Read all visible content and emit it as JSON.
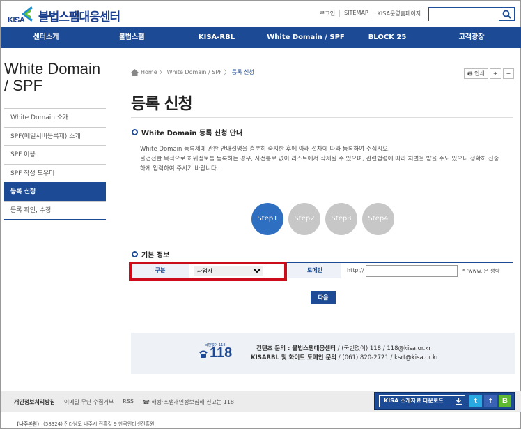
{
  "header": {
    "logo_text": "KISA",
    "site_title": "불법스팸대응센터",
    "top_links": [
      "로그인",
      "SITEMAP",
      "KISA운영홈페이지"
    ],
    "search_placeholder": ""
  },
  "gnb": [
    "센터소개",
    "불법스팸",
    "KISA-RBL",
    "White Domain / SPF",
    "BLOCK 25",
    "고객광장"
  ],
  "sidebar": {
    "title": "White Domain / SPF",
    "items": [
      {
        "label": "White Domain 소개",
        "active": false
      },
      {
        "label": "SPF(메일서버등록제) 소개",
        "active": false
      },
      {
        "label": "SPF 이용",
        "active": false
      },
      {
        "label": "SPF 작성 도우미",
        "active": false
      },
      {
        "label": "등록 신청",
        "active": true
      },
      {
        "label": "등록 확인, 수정",
        "active": false
      }
    ]
  },
  "breadcrumb": {
    "home": "Home",
    "parent": "White Domain / SPF",
    "current": "등록 신청"
  },
  "tools": {
    "print": "인쇄",
    "zoom_in": "+",
    "zoom_out": "−"
  },
  "page_title": "등록 신청",
  "section1": {
    "title": "White Domain 등록 신청 안내",
    "line1": "White Domain 등록제에 관한 안내설명을 충분히 숙지한 후에 아래 절차에 따라 등록하여 주십시오.",
    "line2": "불건전한 목적으로 허위정보를 등록하는 경우, 사전통보 없이 리스트에서 삭제될 수 있으며, 관련법령에 따라 처벌을 받을 수도 있으니 정확히 신중",
    "line3": "하게 입력하여 주시기 바랍니다."
  },
  "steps": [
    {
      "label": "Step1",
      "active": true
    },
    {
      "label": "Step2",
      "active": false
    },
    {
      "label": "Step3",
      "active": false
    },
    {
      "label": "Step4",
      "active": false
    }
  ],
  "section2": {
    "title": "기본 정보",
    "type_label": "구분",
    "type_value": "사업자",
    "domain_label": "도메인",
    "domain_prefix": "http://",
    "domain_value": "",
    "domain_hint": "* 'www.'은 생략"
  },
  "next_button": "다음",
  "contact": {
    "tagline": "국번없이 118",
    "number": "118",
    "line1_bold": "컨텐츠 문의 : 불법스팸대응센터",
    "line1_rest": " / (국번없이) 118 / 118@kisa.or.kr",
    "line2_bold": "KISARBL 및 화이트 도메인 문의",
    "line2_rest": " / (061) 820-2721 / ksrt@kisa.or.kr"
  },
  "footer": {
    "links": [
      "개인정보처리방침",
      "이메일 무단 수집거부",
      "RSS",
      "☎ 해킹·스팸개인정보침해 신고는 118"
    ],
    "download": "KISA 소개자료 다운로드",
    "sns": [
      "t",
      "f",
      "B"
    ],
    "bottom": [
      "(나주본원)",
      "(58324) 전라남도 나주시 진흥길 9 한국인터넷진흥원"
    ]
  },
  "colors": {
    "brand": "#1c4a94",
    "highlight": "#cc0b1b",
    "step_active": "#2f6fc1",
    "step_inactive": "#c7c7c7"
  }
}
